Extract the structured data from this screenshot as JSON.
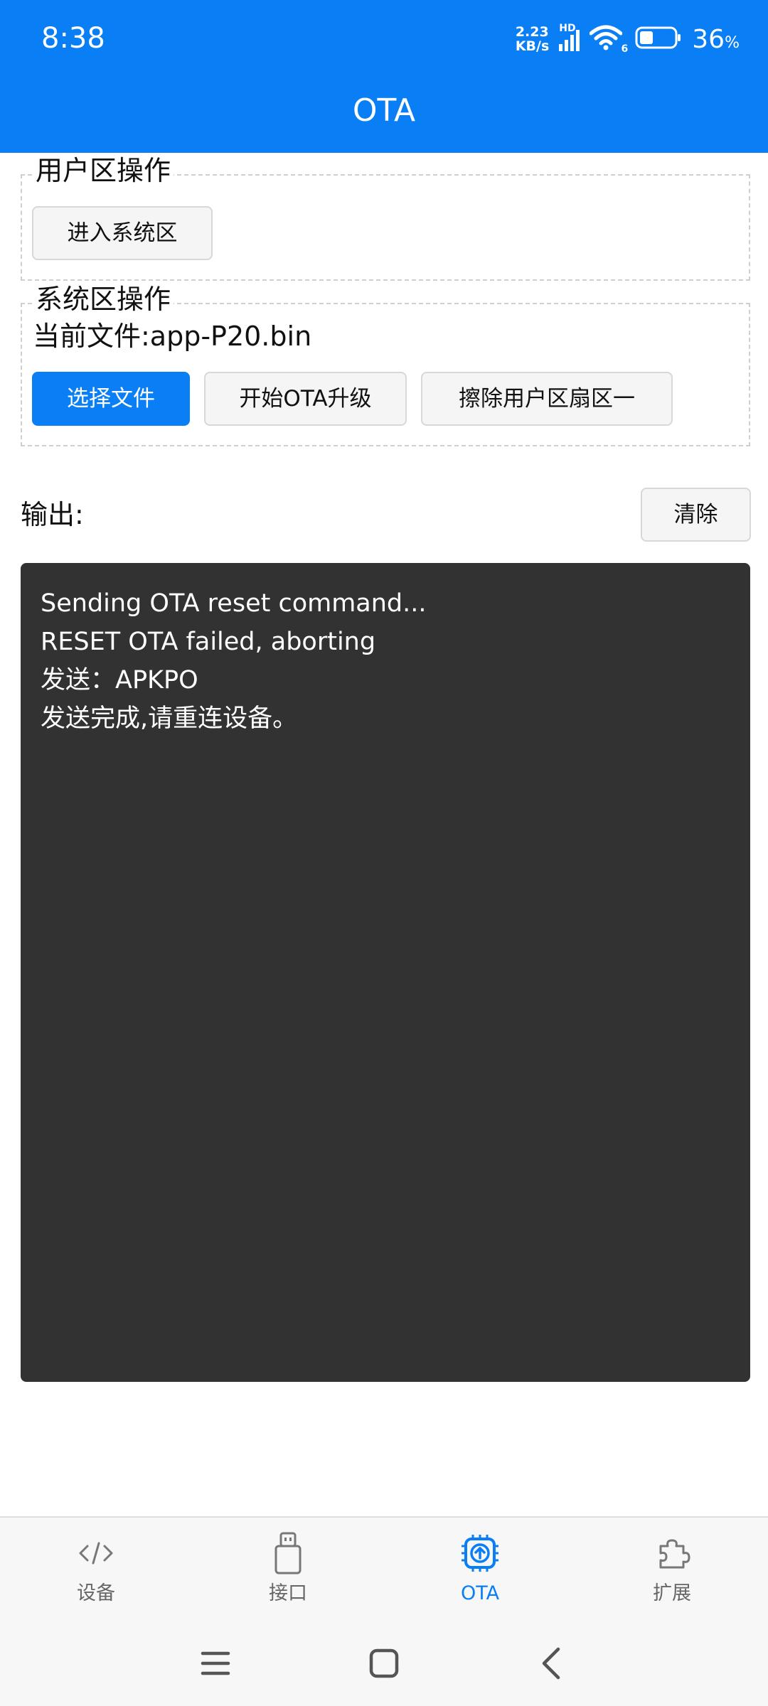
{
  "status_bar": {
    "time": "8:38",
    "net_speed_value": "2.23",
    "net_speed_unit": "KB/s",
    "network_tag": "HD",
    "wifi_tag": "6",
    "battery_percent": "36",
    "battery_percent_sign": "%"
  },
  "header": {
    "title": "OTA"
  },
  "user_section": {
    "legend": "用户区操作",
    "enter_system_button": "进入系统区"
  },
  "system_section": {
    "legend": "系统区操作",
    "current_file": "当前文件:app-P20.bin",
    "select_file_button": "选择文件",
    "start_ota_button": "开始OTA升级",
    "erase_button": "擦除用户区扇区一"
  },
  "output": {
    "label": "输出:",
    "clear_button": "清除",
    "lines": [
      "Sending OTA reset command...",
      "RESET OTA failed, aborting",
      "发送：APKPO",
      "发送完成,请重连设备。"
    ]
  },
  "bottom_nav": {
    "tabs": [
      {
        "label": "设备",
        "icon": "code-icon",
        "active": false
      },
      {
        "label": "接口",
        "icon": "usb-icon",
        "active": false
      },
      {
        "label": "OTA",
        "icon": "chip-upload-icon",
        "active": true
      },
      {
        "label": "扩展",
        "icon": "puzzle-icon",
        "active": false
      }
    ]
  },
  "colors": {
    "primary": "#0a7ff5",
    "console_bg": "#323232",
    "inactive_tab": "#666666"
  }
}
